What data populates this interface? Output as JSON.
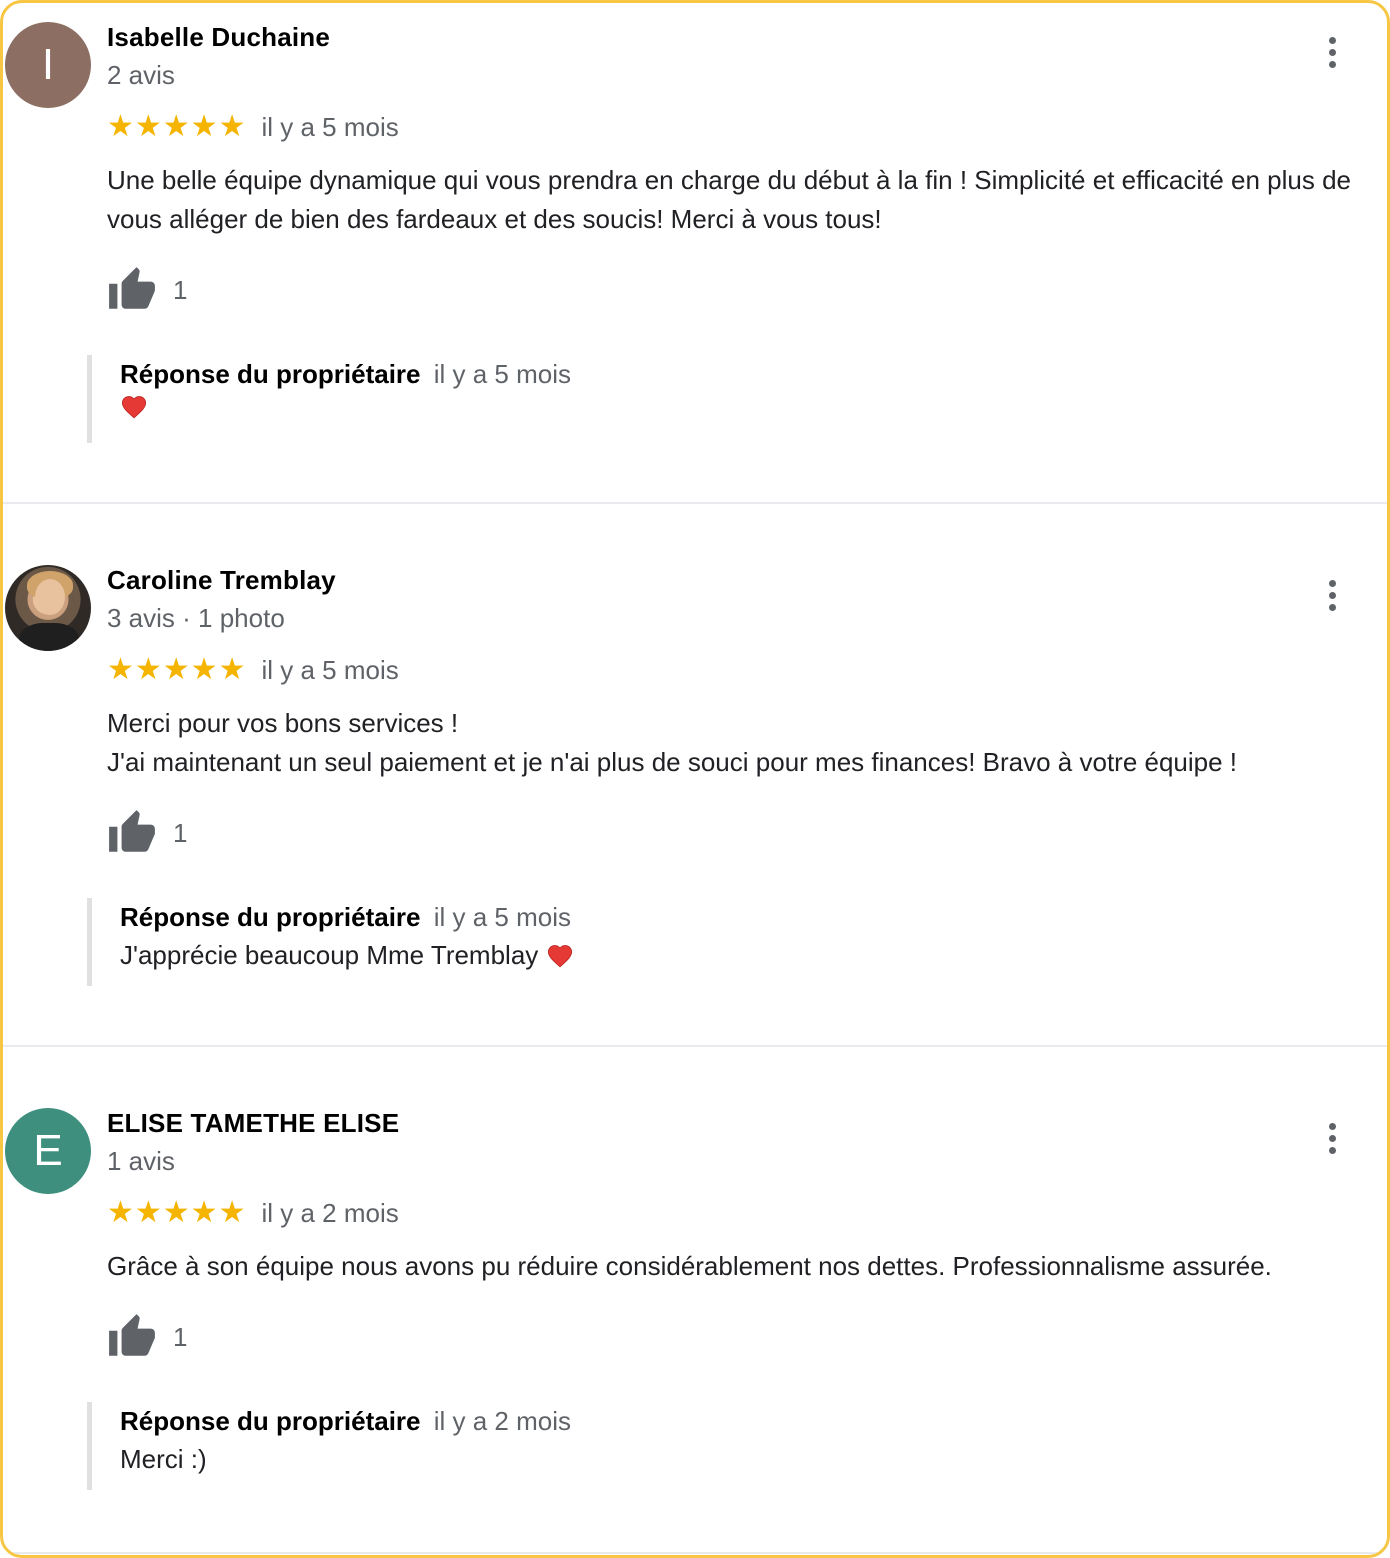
{
  "reviews": [
    {
      "author": "Isabelle Duchaine",
      "avatar_initial": "I",
      "avatar_color": "#8d6e63",
      "meta": "2 avis",
      "stars": "★★★★★",
      "rating": 5,
      "time": "il y a 5 mois",
      "text": "Une belle équipe dynamique qui vous prendra en charge du début à la fin ! Simplicité et efficacité en plus de vous alléger de bien des fardeaux et des soucis! Merci à vous tous!",
      "likes": "1",
      "reply": {
        "title": "Réponse du propriétaire",
        "time": "il y a 5 mois",
        "text": "",
        "emoji": "heart-icon"
      }
    },
    {
      "author": "Caroline Tremblay",
      "avatar_initial": "",
      "avatar_color": "#3a3330",
      "meta": "3 avis · 1 photo",
      "stars": "★★★★★",
      "rating": 5,
      "time": "il y a 5 mois",
      "text": "Merci pour vos bons services !\nJ'ai maintenant un seul paiement et je n'ai plus de souci pour mes finances! Bravo à votre équipe !",
      "likes": "1",
      "reply": {
        "title": "Réponse du propriétaire",
        "time": "il y a 5 mois",
        "text": "J'apprécie beaucoup Mme Tremblay",
        "emoji": "heart-icon"
      }
    },
    {
      "author": "ELISE TAMETHE ELISE",
      "avatar_initial": "E",
      "avatar_color": "#3f8f7e",
      "meta": "1 avis",
      "stars": "★★★★★",
      "rating": 5,
      "time": "il y a 2 mois",
      "text": "Grâce à son équipe nous avons pu réduire considérablement nos dettes. Professionnalisme assurée.",
      "likes": "1",
      "reply": {
        "title": "Réponse du propriétaire",
        "time": "il y a 2 mois",
        "text": "Merci :)",
        "emoji": ""
      }
    }
  ],
  "colors": {
    "frame_border": "#f6c644",
    "star": "#f4b400",
    "secondary_text": "#5f6368",
    "heart": "#e53935"
  }
}
